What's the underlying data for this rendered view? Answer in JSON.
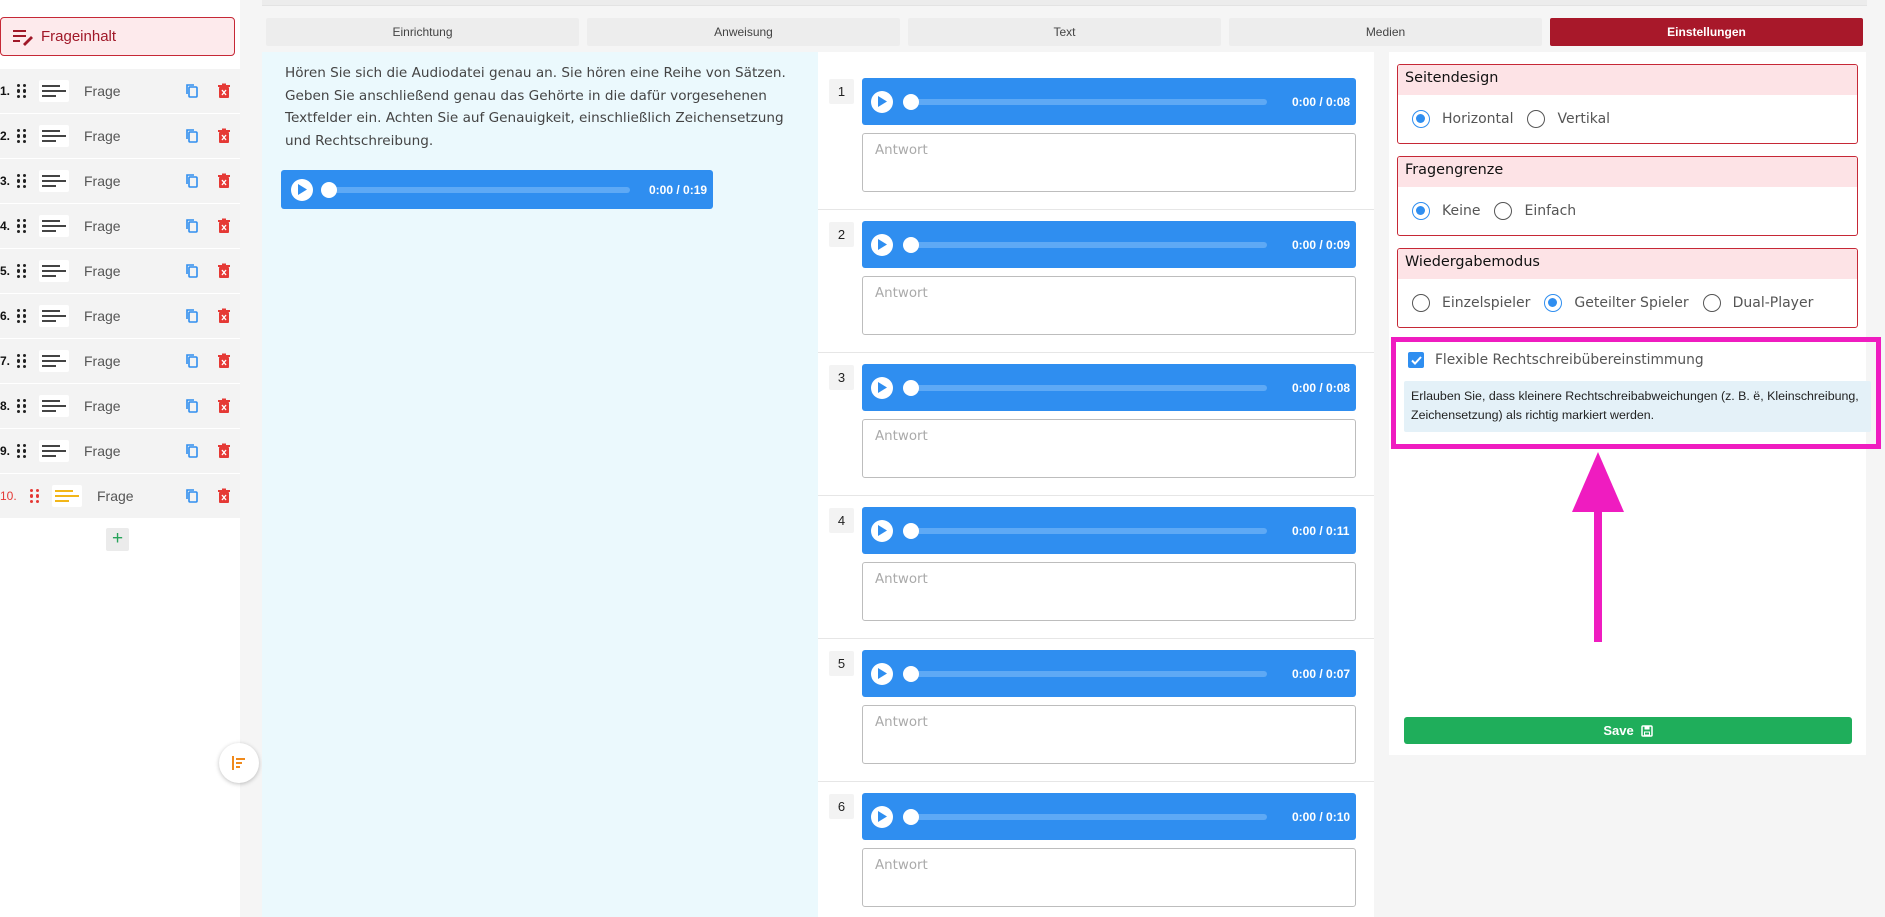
{
  "sidebar": {
    "header_label": "Frageinhalt",
    "items": [
      {
        "num": "1.",
        "label": "Frage"
      },
      {
        "num": "2.",
        "label": "Frage"
      },
      {
        "num": "3.",
        "label": "Frage"
      },
      {
        "num": "4.",
        "label": "Frage"
      },
      {
        "num": "5.",
        "label": "Frage"
      },
      {
        "num": "6.",
        "label": "Frage"
      },
      {
        "num": "7.",
        "label": "Frage"
      },
      {
        "num": "8.",
        "label": "Frage"
      },
      {
        "num": "9.",
        "label": "Frage"
      },
      {
        "num": "10.",
        "label": "Frage"
      }
    ],
    "active_index": 9,
    "add_label": "+"
  },
  "tabs": [
    {
      "label": "Einrichtung",
      "active": false
    },
    {
      "label": "Anweisung",
      "active": false
    },
    {
      "label": "Text",
      "active": false
    },
    {
      "label": "Medien",
      "active": false
    },
    {
      "label": "Einstellungen",
      "active": true
    }
  ],
  "instructions": {
    "text": "Hören Sie sich die Audiodatei genau an. Sie hören eine Reihe von Sätzen. Geben Sie anschließend genau das Gehörte in die dafür vorgesehenen Textfelder ein. Achten Sie auf Genauigkeit, einschließlich Zeichensetzung und Rechtschreibung.",
    "player_time": "0:00 / 0:19"
  },
  "questions": [
    {
      "num": "1",
      "time": "0:00 / 0:08",
      "placeholder": "Antwort"
    },
    {
      "num": "2",
      "time": "0:00 / 0:09",
      "placeholder": "Antwort"
    },
    {
      "num": "3",
      "time": "0:00 / 0:08",
      "placeholder": "Antwort"
    },
    {
      "num": "4",
      "time": "0:00 / 0:11",
      "placeholder": "Antwort"
    },
    {
      "num": "5",
      "time": "0:00 / 0:07",
      "placeholder": "Antwort"
    },
    {
      "num": "6",
      "time": "0:00 / 0:10",
      "placeholder": "Antwort"
    }
  ],
  "settings": {
    "page_design": {
      "title": "Seitendesign",
      "options": [
        "Horizontal",
        "Vertikal"
      ],
      "selected": "Horizontal"
    },
    "question_limit": {
      "title": "Fragengrenze",
      "options": [
        "Keine",
        "Einfach"
      ],
      "selected": "Keine"
    },
    "playback_mode": {
      "title": "Wiedergabemodus",
      "options": [
        "Einzelspieler",
        "Geteilter Spieler",
        "Dual-Player"
      ],
      "selected": "Geteilter Spieler"
    },
    "flexible_spelling": {
      "label": "Flexible Rechtschreibübereinstimmung",
      "checked": true,
      "description": "Erlauben Sie, dass kleinere Rechtschreibabweichungen (z. B. ë, Kleinschreibung, Zeichensetzung) als richtig markiert werden."
    },
    "save_label": "Save"
  },
  "colors": {
    "accent_red": "#a8182a",
    "player_blue": "#2f8ef0",
    "save_green": "#1fae5b",
    "highlight_magenta": "#ef1cc0"
  }
}
